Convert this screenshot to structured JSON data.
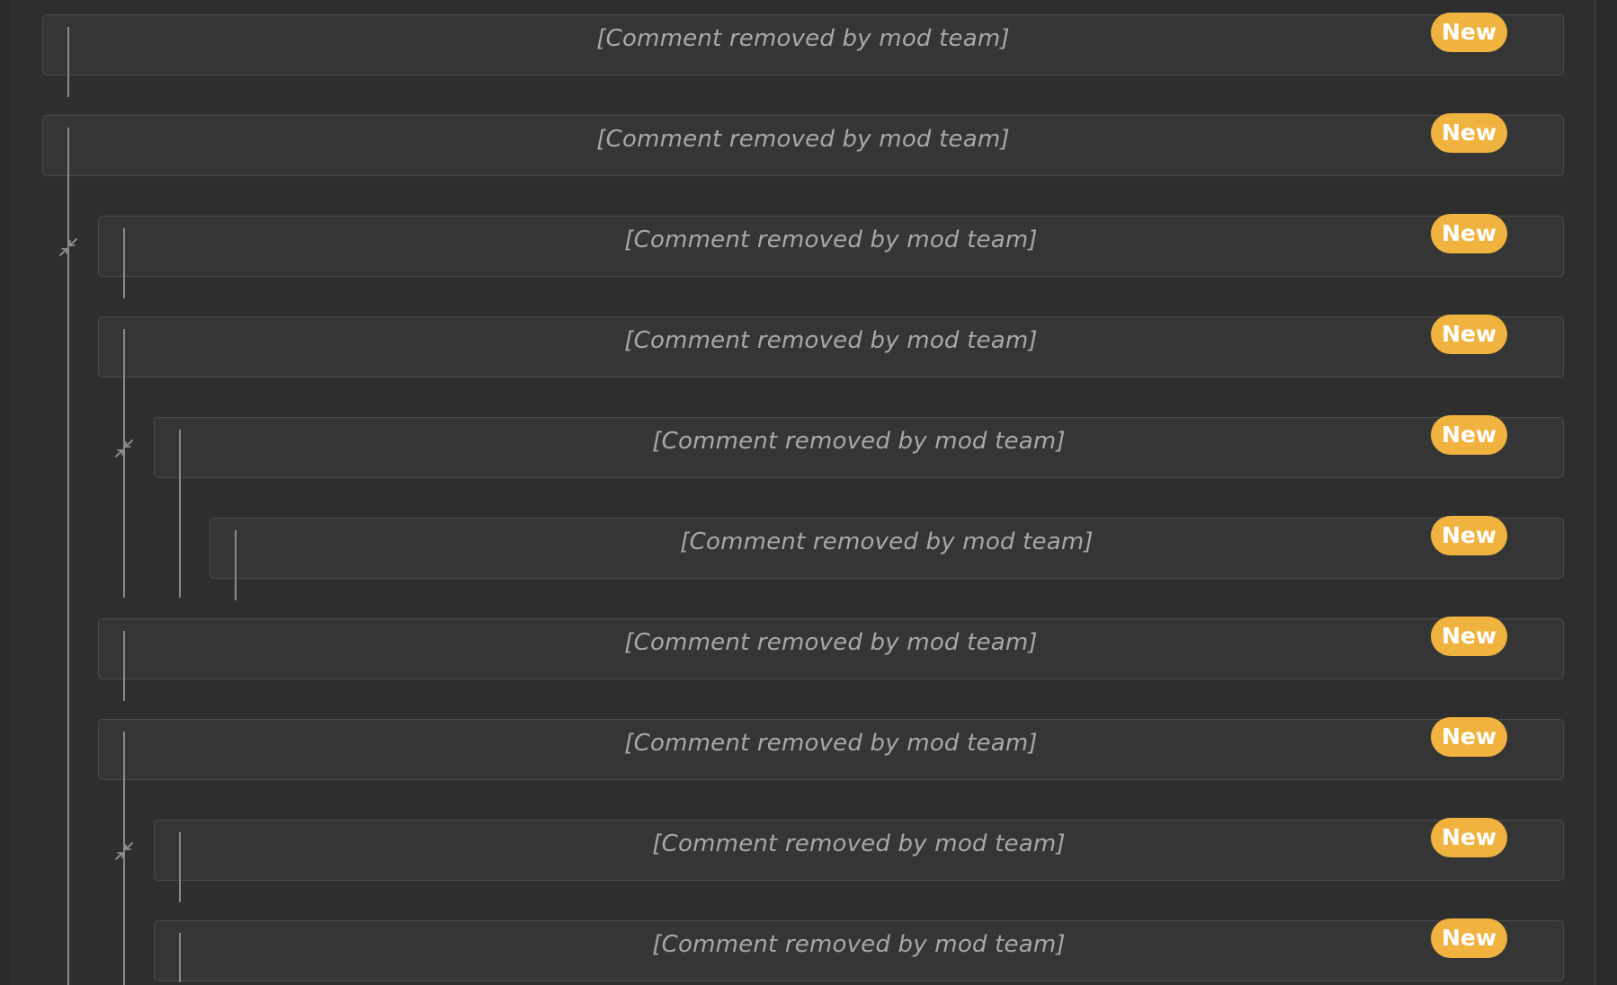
{
  "comments": [
    {
      "text": "[Comment removed by mod team]",
      "badge": "New"
    },
    {
      "text": "[Comment removed by mod team]",
      "badge": "New"
    },
    {
      "text": "[Comment removed by mod team]",
      "badge": "New"
    },
    {
      "text": "[Comment removed by mod team]",
      "badge": "New"
    },
    {
      "text": "[Comment removed by mod team]",
      "badge": "New"
    },
    {
      "text": "[Comment removed by mod team]",
      "badge": "New"
    },
    {
      "text": "[Comment removed by mod team]",
      "badge": "New"
    },
    {
      "text": "[Comment removed by mod team]",
      "badge": "New"
    },
    {
      "text": "[Comment removed by mod team]",
      "badge": "New"
    },
    {
      "text": "[Comment removed by mod team]",
      "badge": "New"
    }
  ],
  "icons": {
    "collapse": "collapse-thread-icon"
  },
  "colors": {
    "badge_bg": "#f1b33f",
    "badge_text": "#ffffff",
    "removed_text": "#a8a8a8",
    "card_bg": "#353535",
    "card_border": "#4a4a4a",
    "thread_line": "#8a8a8a"
  }
}
